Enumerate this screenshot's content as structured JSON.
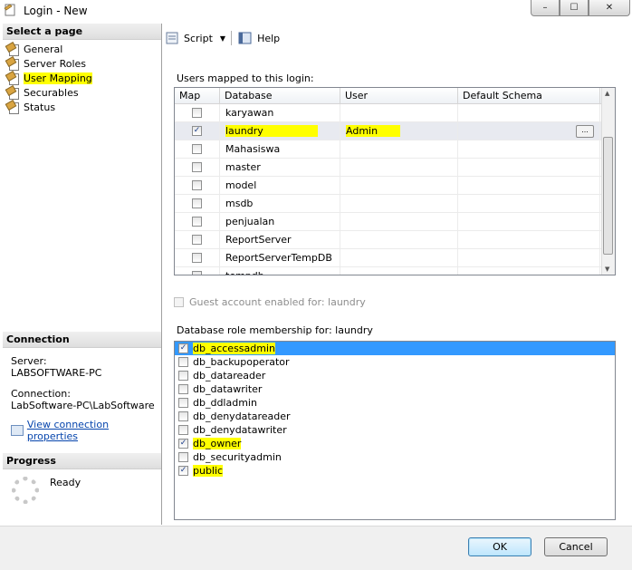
{
  "window": {
    "title": "Login - New",
    "minimize": "–",
    "maximize": "☐",
    "close": "✕"
  },
  "left": {
    "select_header": "Select a page",
    "pages": [
      {
        "label": "General",
        "highlighted": false
      },
      {
        "label": "Server Roles",
        "highlighted": false
      },
      {
        "label": "User Mapping",
        "highlighted": true
      },
      {
        "label": "Securables",
        "highlighted": false
      },
      {
        "label": "Status",
        "highlighted": false
      }
    ],
    "connection_header": "Connection",
    "server_label": "Server:",
    "server_value": "LABSOFTWARE-PC",
    "connection_label": "Connection:",
    "connection_value": "LabSoftware-PC\\LabSoftware",
    "view_link": "View connection properties",
    "progress_header": "Progress",
    "progress_status": "Ready"
  },
  "toolbar": {
    "script_label": "Script",
    "help_label": "Help"
  },
  "mapping": {
    "title": "Users mapped to this login:",
    "columns": [
      "Map",
      "Database",
      "User",
      "Default Schema"
    ],
    "rows": [
      {
        "checked": false,
        "database": "karyawan",
        "user": "",
        "schema": ""
      },
      {
        "checked": true,
        "database": "laundry",
        "user": "Admin",
        "schema": "",
        "selected": true
      },
      {
        "checked": false,
        "database": "Mahasiswa",
        "user": "",
        "schema": ""
      },
      {
        "checked": false,
        "database": "master",
        "user": "",
        "schema": ""
      },
      {
        "checked": false,
        "database": "model",
        "user": "",
        "schema": ""
      },
      {
        "checked": false,
        "database": "msdb",
        "user": "",
        "schema": ""
      },
      {
        "checked": false,
        "database": "penjualan",
        "user": "",
        "schema": ""
      },
      {
        "checked": false,
        "database": "ReportServer",
        "user": "",
        "schema": ""
      },
      {
        "checked": false,
        "database": "ReportServerTempDB",
        "user": "",
        "schema": ""
      },
      {
        "checked": false,
        "database": "tempdb",
        "user": "",
        "schema": ""
      }
    ],
    "ellipsis": "..."
  },
  "guest_label": "Guest account enabled for: laundry",
  "roles": {
    "title": "Database role membership for: laundry",
    "items": [
      {
        "label": "db_accessadmin",
        "checked": true,
        "highlighted": true,
        "selected": true
      },
      {
        "label": "db_backupoperator",
        "checked": false
      },
      {
        "label": "db_datareader",
        "checked": false
      },
      {
        "label": "db_datawriter",
        "checked": false
      },
      {
        "label": "db_ddladmin",
        "checked": false
      },
      {
        "label": "db_denydatareader",
        "checked": false
      },
      {
        "label": "db_denydatawriter",
        "checked": false
      },
      {
        "label": "db_owner",
        "checked": true,
        "highlighted": true
      },
      {
        "label": "db_securityadmin",
        "checked": false
      },
      {
        "label": "public",
        "checked": true,
        "highlighted": true
      }
    ]
  },
  "buttons": {
    "ok": "OK",
    "cancel": "Cancel"
  },
  "colors": {
    "highlight": "#ffff00",
    "selection": "#3399ff",
    "link": "#0645ad"
  }
}
